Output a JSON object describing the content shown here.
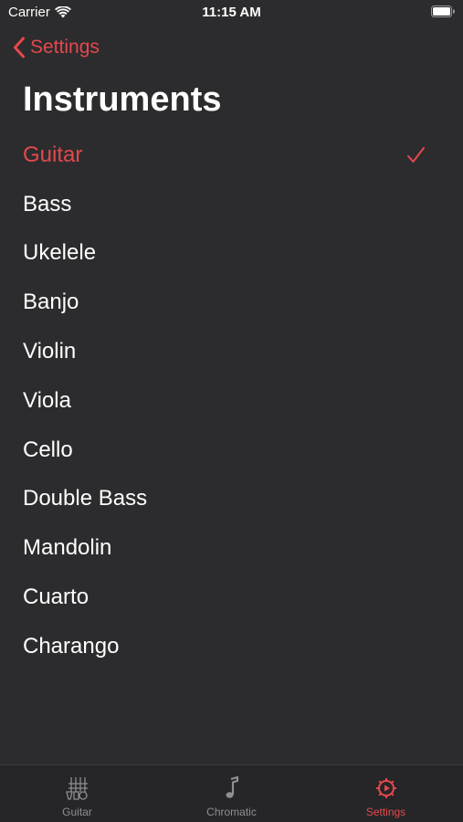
{
  "status_bar": {
    "carrier": "Carrier",
    "time": "11:15 AM"
  },
  "nav": {
    "back_label": "Settings",
    "title": "Instruments"
  },
  "instruments": [
    {
      "label": "Guitar",
      "selected": true
    },
    {
      "label": "Bass",
      "selected": false
    },
    {
      "label": "Ukelele",
      "selected": false
    },
    {
      "label": "Banjo",
      "selected": false
    },
    {
      "label": "Violin",
      "selected": false
    },
    {
      "label": "Viola",
      "selected": false
    },
    {
      "label": "Cello",
      "selected": false
    },
    {
      "label": "Double Bass",
      "selected": false
    },
    {
      "label": "Mandolin",
      "selected": false
    },
    {
      "label": "Cuarto",
      "selected": false
    },
    {
      "label": "Charango",
      "selected": false
    }
  ],
  "tab_bar": {
    "tabs": [
      {
        "label": "Guitar",
        "icon": "guitar-strings-icon",
        "active": false
      },
      {
        "label": "Chromatic",
        "icon": "music-note-icon",
        "active": false
      },
      {
        "label": "Settings",
        "icon": "settings-gear-icon",
        "active": true
      }
    ]
  },
  "colors": {
    "background": "#2c2c2e",
    "accent": "#e5484d",
    "text": "#ffffff",
    "inactive_tab": "#8e8e93",
    "tab_bar_background": "#262628"
  }
}
